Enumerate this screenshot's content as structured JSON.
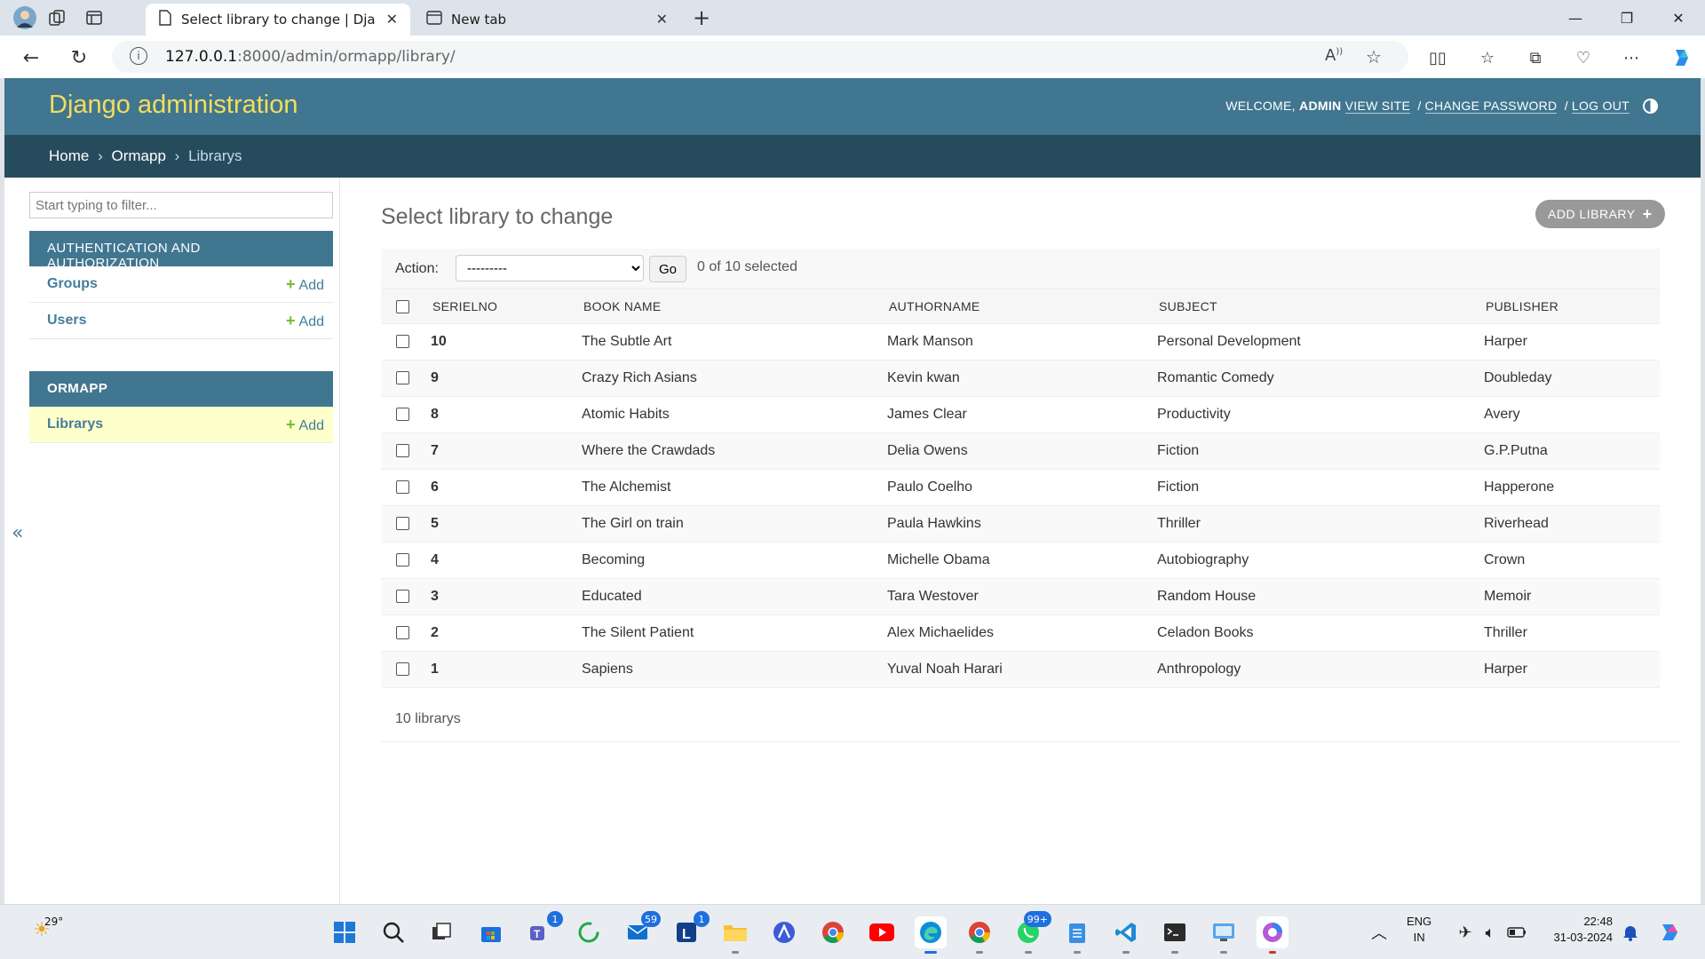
{
  "browser": {
    "tabs": [
      {
        "title": "Select library to change | Django",
        "active": true
      },
      {
        "title": "New tab",
        "active": false
      }
    ],
    "url_host": "127.0.0.1",
    "url_path": ":8000/admin/ormapp/library/"
  },
  "header": {
    "site_name": "Django administration",
    "welcome": "WELCOME,",
    "username": "ADMIN",
    "view_site": "VIEW SITE",
    "change_password": "CHANGE PASSWORD",
    "log_out": "LOG OUT",
    "separator": "/"
  },
  "breadcrumbs": {
    "home": "Home",
    "app": "Ormapp",
    "current": "Librarys",
    "sep": "›"
  },
  "sidebar": {
    "filter_placeholder": "Start typing to filter...",
    "toggle": "«",
    "modules": [
      {
        "caption": "AUTHENTICATION AND AUTHORIZATION",
        "models": [
          {
            "name": "Groups",
            "add": "Add"
          },
          {
            "name": "Users",
            "add": "Add"
          }
        ]
      },
      {
        "caption": "ORMAPP",
        "models": [
          {
            "name": "Librarys",
            "add": "Add",
            "current": true
          }
        ]
      }
    ]
  },
  "content": {
    "title": "Select library to change",
    "add_button": "ADD LIBRARY",
    "action_label": "Action:",
    "action_selected": "---------",
    "go": "Go",
    "selected_count": "0 of 10 selected",
    "columns": [
      "SERIELNO",
      "BOOK NAME",
      "AUTHORNAME",
      "SUBJECT",
      "PUBLISHER"
    ],
    "rows": [
      [
        "10",
        "The Subtle Art",
        "Mark Manson",
        "Personal Development",
        "Harper"
      ],
      [
        "9",
        "Crazy Rich Asians",
        "Kevin kwan",
        "Romantic Comedy",
        "Doubleday"
      ],
      [
        "8",
        "Atomic Habits",
        "James Clear",
        "Productivity",
        "Avery"
      ],
      [
        "7",
        "Where the Crawdads",
        "Delia Owens",
        "Fiction",
        "G.P.Putna"
      ],
      [
        "6",
        "The Alchemist",
        "Paulo Coelho",
        "Fiction",
        "Happerone"
      ],
      [
        "5",
        "The Girl on train",
        "Paula Hawkins",
        "Thriller",
        "Riverhead"
      ],
      [
        "4",
        "Becoming",
        "Michelle Obama",
        "Autobiography",
        "Crown"
      ],
      [
        "3",
        "Educated",
        "Tara Westover",
        "Random House",
        "Memoir"
      ],
      [
        "2",
        "The Silent Patient",
        "Alex Michaelides",
        "Celadon Books",
        "Thriller"
      ],
      [
        "1",
        "Sapiens",
        "Yuval Noah Harari",
        "Anthropology",
        "Harper"
      ]
    ],
    "paginator": "10 librarys"
  },
  "taskbar": {
    "weather": "29°",
    "lang_top": "ENG",
    "lang_bottom": "IN",
    "time": "22:48",
    "date": "31-03-2024",
    "badges": {
      "teams": "1",
      "mail": "59",
      "ltool": "1",
      "whatsapp": "99+"
    }
  },
  "colors": {
    "header_bg": "#417690",
    "breadcrumbs_bg": "#264b5d",
    "site_name": "#f5dd5d",
    "link": "#447e9b",
    "add_green": "#70bf2b",
    "current_row": "#ffffcc"
  }
}
